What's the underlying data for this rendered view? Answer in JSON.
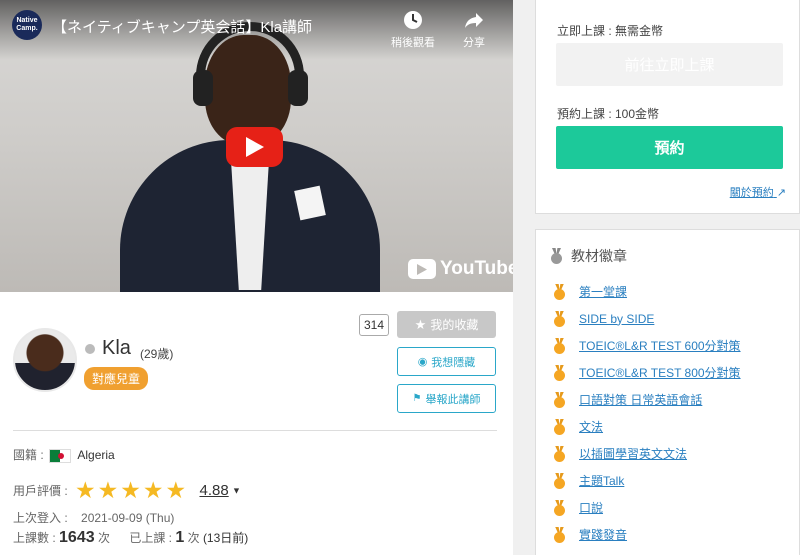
{
  "video": {
    "channel_logo_text": "Native Camp.",
    "title": "【ネイティブキャンプ英会話】Kla講師",
    "watch_later_label": "稍後觀看",
    "share_label": "分享",
    "brand": "YouTube"
  },
  "teacher": {
    "name": "Kla",
    "age": "(29歲)",
    "kids_badge": "對應兒童",
    "favorite_count": "314",
    "favorite_label": "我的收藏",
    "hide_label": "我想隱藏",
    "report_label": "舉報此講師",
    "nationality_label": "國籍 :",
    "nationality": "Algeria",
    "rating_label": "用戶評價 :",
    "rating_stars": 5,
    "rating_value": "4.88",
    "last_login_label": "上次登入 :",
    "last_login_value": "2021-09-09 (Thu)",
    "lessons_label": "上課數 :",
    "lessons_count": "1643",
    "lessons_unit": "次",
    "taken_label": "已上課 :",
    "taken_count": "1",
    "taken_unit": "次",
    "taken_ago": "(13日前)"
  },
  "booking": {
    "instant_label": "立即上課 : 無需金幣",
    "instant_button": "前往立即上課",
    "reserve_label": "預約上課 : 100金幣",
    "reserve_button": "預約",
    "about_link": "關於預約"
  },
  "materials": {
    "title": "教材徽章",
    "items": [
      "第一堂課",
      "SIDE by SIDE",
      "TOEIC®L&R TEST 600分對策",
      "TOEIC®L&R TEST 800分對策",
      "口語對策 日常英語會話",
      "文法",
      "以插圖學習英文文法",
      "主題Talk",
      "口說",
      "實踐發音"
    ]
  },
  "colors": {
    "accent_green": "#1cc99a",
    "link_blue": "#2a7fc0",
    "badge_orange": "#f0a030",
    "star_yellow": "#f5b923",
    "outline_blue": "#2aa7c9"
  }
}
